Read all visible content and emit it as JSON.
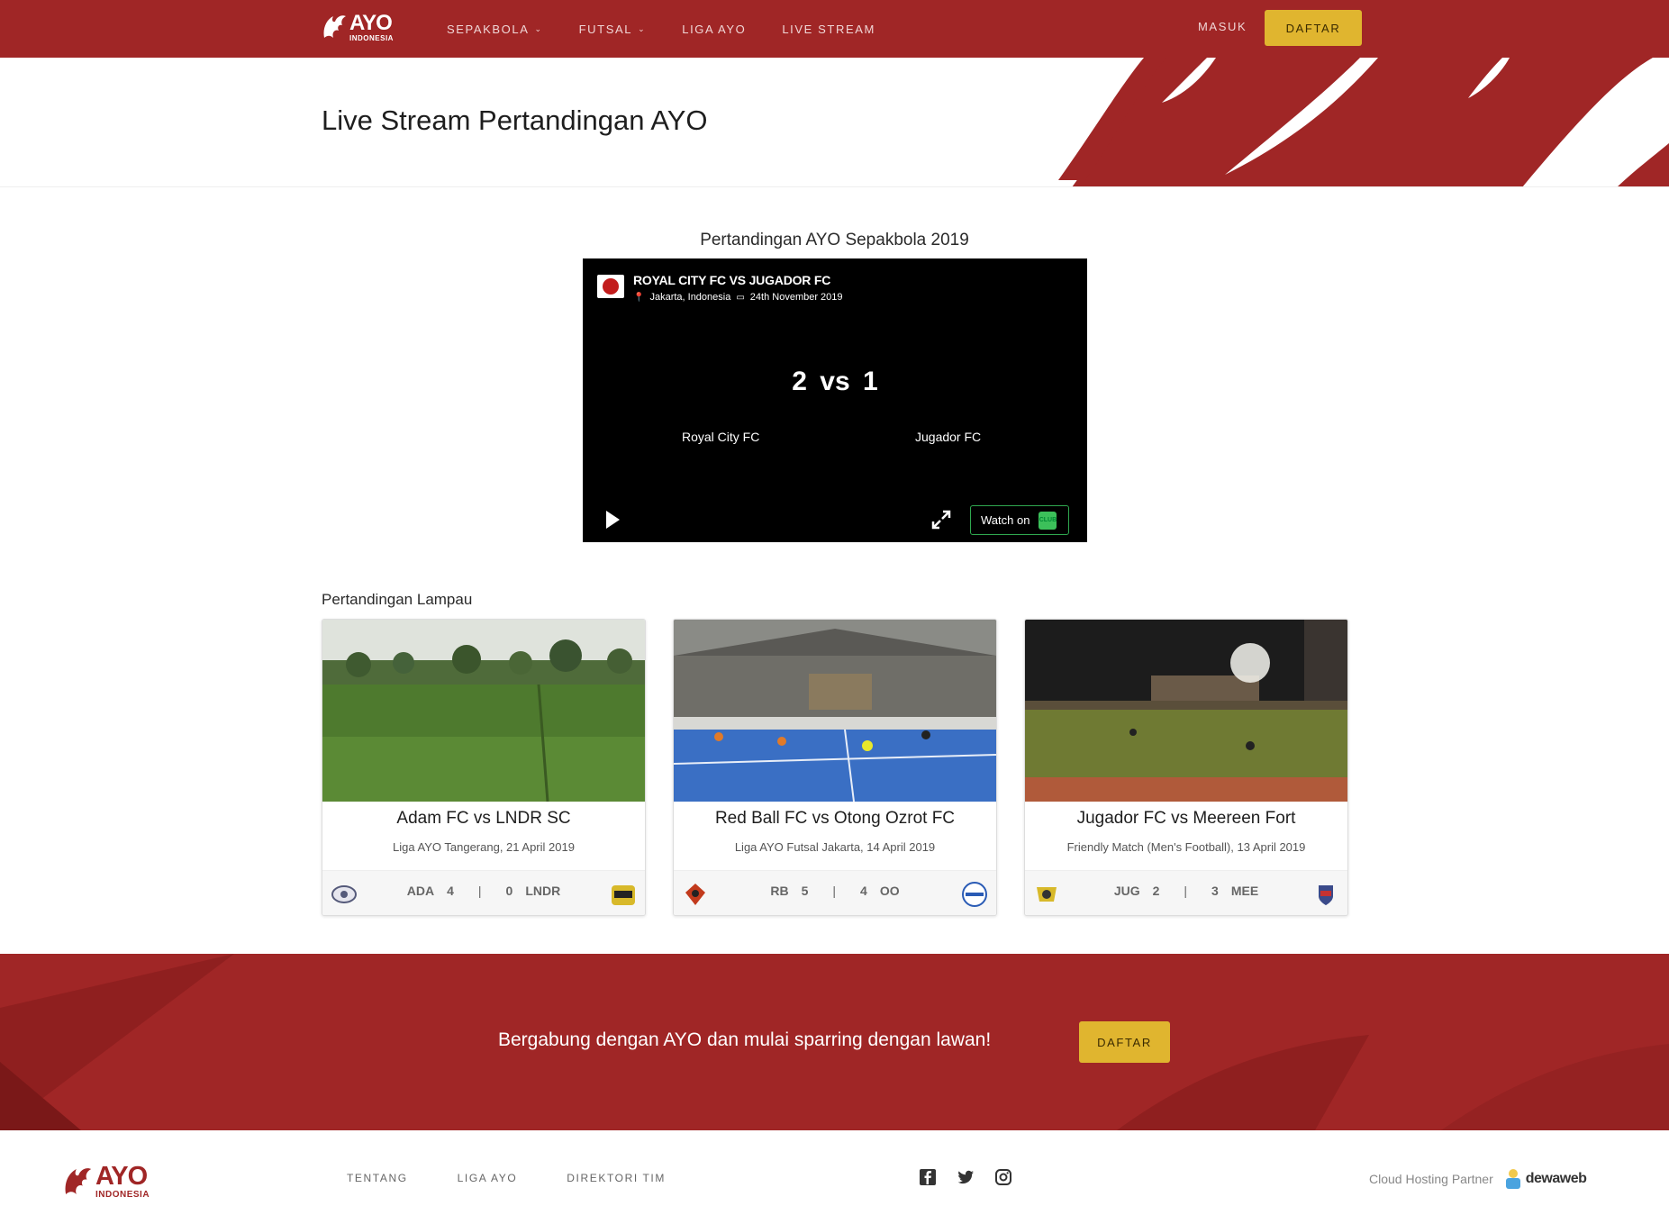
{
  "nav": {
    "logo_main": "AYO",
    "logo_sub": "INDONESIA",
    "items": [
      {
        "label": "SEPAKBOLA",
        "dropdown": true
      },
      {
        "label": "FUTSAL",
        "dropdown": true
      },
      {
        "label": "LIGA AYO",
        "dropdown": false
      },
      {
        "label": "LIVE STREAM",
        "dropdown": false
      }
    ],
    "login": "MASUK",
    "signup": "DAFTAR"
  },
  "hero": {
    "title": "Live Stream Pertandingan AYO"
  },
  "live": {
    "section_title": "Pertandingan AYO Sepakbola 2019",
    "match_title": "ROYAL CITY FC VS JUGADOR FC",
    "location": "Jakarta, Indonesia",
    "date": "24th November 2019",
    "score": "2 vs 1",
    "home_team": "Royal City FC",
    "away_team": "Jugador FC",
    "watch_on": "Watch on",
    "watch_logo_text": "CLUB"
  },
  "past": {
    "title": "Pertandingan Lampau",
    "matches": [
      {
        "title": "Adam FC vs LNDR SC",
        "subtitle": "Liga AYO Tangerang, 21 April 2019",
        "home_abbr": "ADA",
        "home_score": "4",
        "sep": "|",
        "away_score": "0",
        "away_abbr": "LNDR"
      },
      {
        "title": "Red Ball FC vs Otong Ozrot FC",
        "subtitle": "Liga AYO Futsal Jakarta, 14 April 2019",
        "home_abbr": "RB",
        "home_score": "5",
        "sep": "|",
        "away_score": "4",
        "away_abbr": "OO"
      },
      {
        "title": "Jugador FC vs Meereen Fort",
        "subtitle": "Friendly Match (Men's Football), 13 April 2019",
        "home_abbr": "JUG",
        "home_score": "2",
        "sep": "|",
        "away_score": "3",
        "away_abbr": "MEE"
      }
    ]
  },
  "cta": {
    "text": "Bergabung dengan AYO dan mulai sparring dengan lawan!",
    "button": "DAFTAR"
  },
  "footer": {
    "logo_main": "AYO",
    "logo_sub": "INDONESIA",
    "links": [
      "TENTANG",
      "LIGA AYO",
      "DIREKTORI TIM"
    ],
    "social": [
      "facebook-icon",
      "twitter-icon",
      "instagram-icon"
    ],
    "hosting_label": "Cloud Hosting Partner",
    "hosting_brand": "dewaweb"
  },
  "colors": {
    "brand_red": "#a02626",
    "accent_yellow": "#e0b52f",
    "player_bg": "#000000",
    "watch_green": "#2fa84f"
  }
}
